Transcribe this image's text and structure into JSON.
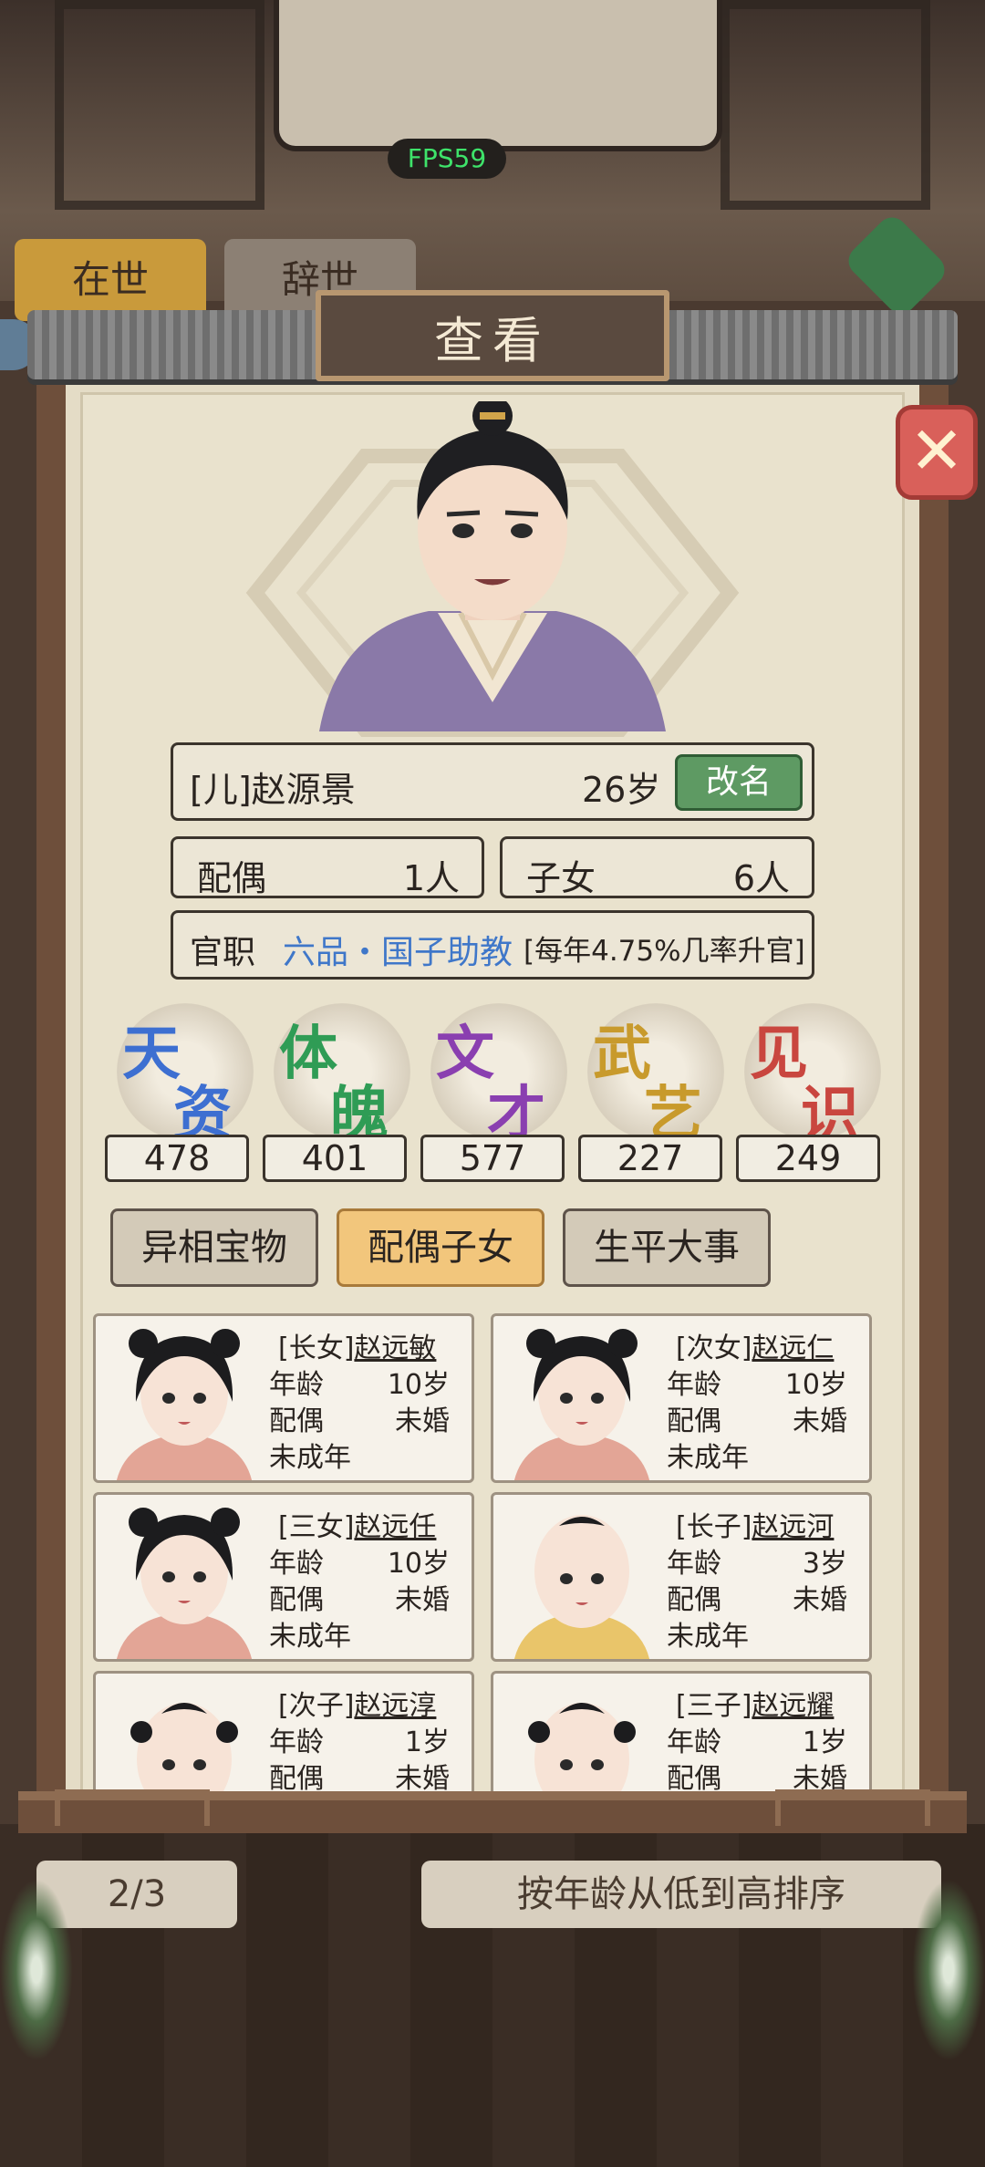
{
  "hud": {
    "fps": "FPS59"
  },
  "background": {
    "tab_alive": "在世",
    "tab_deceased": "辞世",
    "pager": "2/3",
    "sort_label": "按年龄从低到高排序"
  },
  "dialog": {
    "title": "查看",
    "person": {
      "name": "[儿]赵源景",
      "age": "26岁",
      "rename_label": "改名",
      "spouse_label": "配偶",
      "spouse_value": "1人",
      "children_label": "子女",
      "children_value": "6人",
      "office_label": "官职",
      "office_rank": "六品・国子助教",
      "office_rate": "[每年4.75%几率升官]"
    },
    "attributes": [
      {
        "c1": "天",
        "c2": "资",
        "value": "478",
        "color": "#3d6fd1"
      },
      {
        "c1": "体",
        "c2": "魄",
        "value": "401",
        "color": "#2f9c55"
      },
      {
        "c1": "文",
        "c2": "才",
        "value": "577",
        "color": "#8a3fb0"
      },
      {
        "c1": "武",
        "c2": "艺",
        "value": "227",
        "color": "#c89a2c"
      },
      {
        "c1": "见",
        "c2": "识",
        "value": "249",
        "color": "#c9463f"
      }
    ],
    "tabs": [
      {
        "label": "异相宝物"
      },
      {
        "label": "配偶子女"
      },
      {
        "label": "生平大事"
      }
    ],
    "children": [
      {
        "prefix": "[长女]",
        "name": "赵远敏",
        "age_label": "年龄",
        "age": "10岁",
        "spouse_label": "配偶",
        "spouse": "未婚",
        "status": "未成年"
      },
      {
        "prefix": "[次女]",
        "name": "赵远仁",
        "age_label": "年龄",
        "age": "10岁",
        "spouse_label": "配偶",
        "spouse": "未婚",
        "status": "未成年"
      },
      {
        "prefix": "[三女]",
        "name": "赵远任",
        "age_label": "年龄",
        "age": "10岁",
        "spouse_label": "配偶",
        "spouse": "未婚",
        "status": "未成年"
      },
      {
        "prefix": "[长子]",
        "name": "赵远河",
        "age_label": "年龄",
        "age": "3岁",
        "spouse_label": "配偶",
        "spouse": "未婚",
        "status": "未成年"
      },
      {
        "prefix": "[次子]",
        "name": "赵远淳",
        "age_label": "年龄",
        "age": "1岁",
        "spouse_label": "配偶",
        "spouse": "未婚",
        "status": ""
      },
      {
        "prefix": "[三子]",
        "name": "赵远耀",
        "age_label": "年龄",
        "age": "1岁",
        "spouse_label": "配偶",
        "spouse": "未婚",
        "status": ""
      }
    ]
  }
}
